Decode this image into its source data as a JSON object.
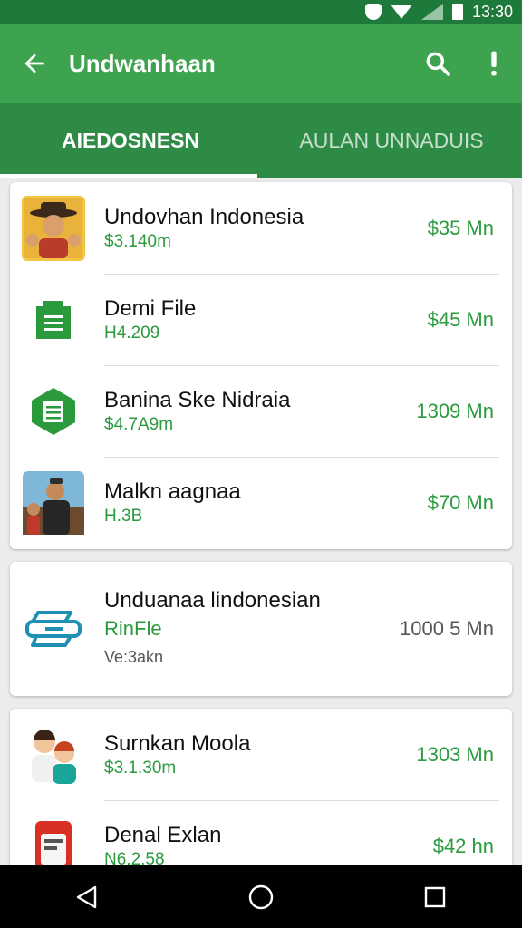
{
  "status_bar": {
    "time": "13:30"
  },
  "app_bar": {
    "title": "Undwanhaan"
  },
  "tabs": [
    {
      "label": "AIEDOSNESN",
      "active": true
    },
    {
      "label": "AULAN UNNADUIS",
      "active": false
    }
  ],
  "card1": {
    "items": [
      {
        "title": "Undovhan Indonesia",
        "subtitle": "$3.140m",
        "price": "$35 Mn",
        "icon": "person-hat-avatar-icon"
      },
      {
        "title": "Demi File",
        "subtitle": "H4.209",
        "price": "$45 Mn",
        "icon": "file-icon"
      },
      {
        "title": "Banina Ske Nidraia",
        "subtitle": "$4.7A9m",
        "price": "1309 Mn",
        "icon": "file-hexagon-icon"
      },
      {
        "title": "Malkn aagnaa",
        "subtitle": "H.3B",
        "price": "$70 Mn",
        "icon": "man-photo-icon"
      }
    ]
  },
  "card2": {
    "title": "Unduanaa lindonesian",
    "subtitle": "RinFle",
    "extra": "Ve:3akn",
    "price": "1000 5 Mn",
    "icon": "printer-icon"
  },
  "card3": {
    "items": [
      {
        "title": "Surnkan Moola",
        "subtitle": "$3.1.30m",
        "price": "1303 Mn",
        "icon": "children-avatar-icon"
      },
      {
        "title": "Denal Exlan",
        "subtitle": "N6.2.58",
        "price": "$42 hn",
        "icon": "phone-card-icon"
      }
    ]
  },
  "colors": {
    "app_bar": "#3ea34f",
    "tab_bar": "#2e8b45",
    "status_bar": "#1e7a3a",
    "accent_green": "#2a9a3d"
  }
}
